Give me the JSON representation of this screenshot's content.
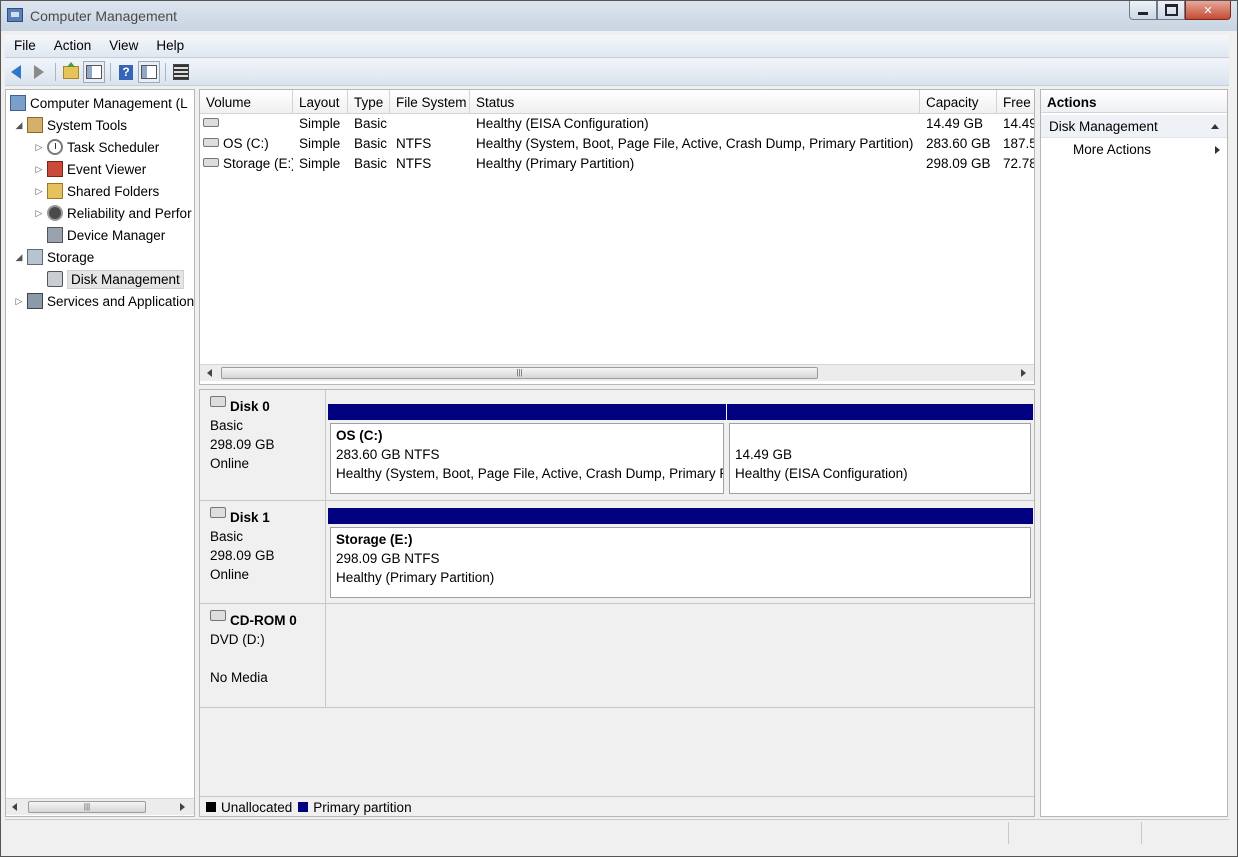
{
  "window": {
    "title": "Computer Management"
  },
  "menu": [
    "File",
    "Action",
    "View",
    "Help"
  ],
  "toolbar": {
    "icons": [
      "back-arrow-icon",
      "forward-arrow-icon",
      "up-folder-icon",
      "show-hide-console-tree-icon",
      "help-icon",
      "show-hide-action-pane-icon",
      "properties-icon"
    ]
  },
  "tree": {
    "items": [
      {
        "label": "Computer Management (L",
        "icon": "computer-management-icon",
        "expander": ""
      },
      {
        "label": "System Tools",
        "icon": "system-tools-icon",
        "expander": "◢"
      },
      {
        "label": "Task Scheduler",
        "icon": "clock-icon",
        "expander": "▷"
      },
      {
        "label": "Event Viewer",
        "icon": "event-viewer-icon",
        "expander": "▷"
      },
      {
        "label": "Shared Folders",
        "icon": "shared-folders-icon",
        "expander": "▷"
      },
      {
        "label": "Reliability and Perfor",
        "icon": "reliability-icon",
        "expander": "▷"
      },
      {
        "label": "Device Manager",
        "icon": "device-manager-icon",
        "expander": ""
      },
      {
        "label": "Storage",
        "icon": "storage-icon",
        "expander": "◢"
      },
      {
        "label": "Disk Management",
        "icon": "disk-management-icon",
        "expander": ""
      },
      {
        "label": "Services and Application",
        "icon": "services-icon",
        "expander": "▷"
      }
    ]
  },
  "volumes": {
    "columns": [
      "Volume",
      "Layout",
      "Type",
      "File System",
      "Status",
      "Capacity",
      "Free S"
    ],
    "rows": [
      {
        "volume": "",
        "layout": "Simple",
        "type": "Basic",
        "fs": "",
        "status": "Healthy (EISA Configuration)",
        "capacity": "14.49 GB",
        "free": "14.49"
      },
      {
        "volume": "OS (C:)",
        "layout": "Simple",
        "type": "Basic",
        "fs": "NTFS",
        "status": "Healthy (System, Boot, Page File, Active, Crash Dump, Primary Partition)",
        "capacity": "283.60 GB",
        "free": "187.5"
      },
      {
        "volume": "Storage (E:)",
        "layout": "Simple",
        "type": "Basic",
        "fs": "NTFS",
        "status": "Healthy (Primary Partition)",
        "capacity": "298.09 GB",
        "free": "72.78"
      }
    ]
  },
  "disks": [
    {
      "name": "Disk 0",
      "type": "Basic",
      "size": "298.09 GB",
      "state": "Online",
      "partitions": [
        {
          "title": "OS  (C:)",
          "size": "283.60 GB NTFS",
          "status": "Healthy (System, Boot, Page File, Active, Crash Dump, Primary Partition)"
        },
        {
          "title": "",
          "size": "14.49 GB",
          "status": "Healthy (EISA Configuration)"
        }
      ]
    },
    {
      "name": "Disk 1",
      "type": "Basic",
      "size": "298.09 GB",
      "state": "Online",
      "partitions": [
        {
          "title": "Storage  (E:)",
          "size": "298.09 GB NTFS",
          "status": "Healthy (Primary Partition)"
        }
      ]
    },
    {
      "name": "CD-ROM 0",
      "type": "DVD (D:)",
      "size": "",
      "state": "No Media",
      "partitions": []
    }
  ],
  "legend": [
    {
      "label": "Unallocated",
      "color": "#000000"
    },
    {
      "label": "Primary partition",
      "color": "#000080"
    }
  ],
  "actions": {
    "header": "Actions",
    "section": "Disk Management",
    "items": [
      "More Actions"
    ]
  }
}
